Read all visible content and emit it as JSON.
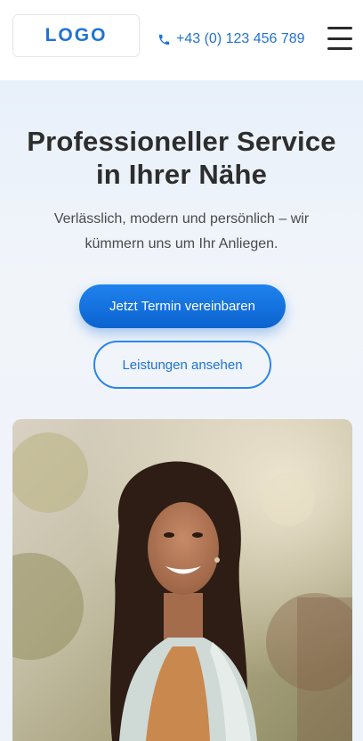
{
  "header": {
    "logo_text": "LOGO",
    "phone_text": "+43 (0) 123 456 789",
    "phone_icon": "phone-icon",
    "menu_icon": "hamburger-menu-icon"
  },
  "hero": {
    "title_line1": "Professioneller Service",
    "title_line2": "in Ihrer Nähe",
    "subtitle_line1": "Verlässlich, modern und persönlich – wir",
    "subtitle_line2": "kümmern uns um Ihr Anliegen.",
    "primary_cta": "Jetzt Termin vereinbaren",
    "secondary_cta": "Leistungen ansehen"
  },
  "colors": {
    "accent": "#1e73d6",
    "button_gradient_start": "#1f82ee",
    "button_gradient_end": "#0b63cf",
    "text_dark": "#2d2d2d",
    "background": "#eef4fb"
  }
}
